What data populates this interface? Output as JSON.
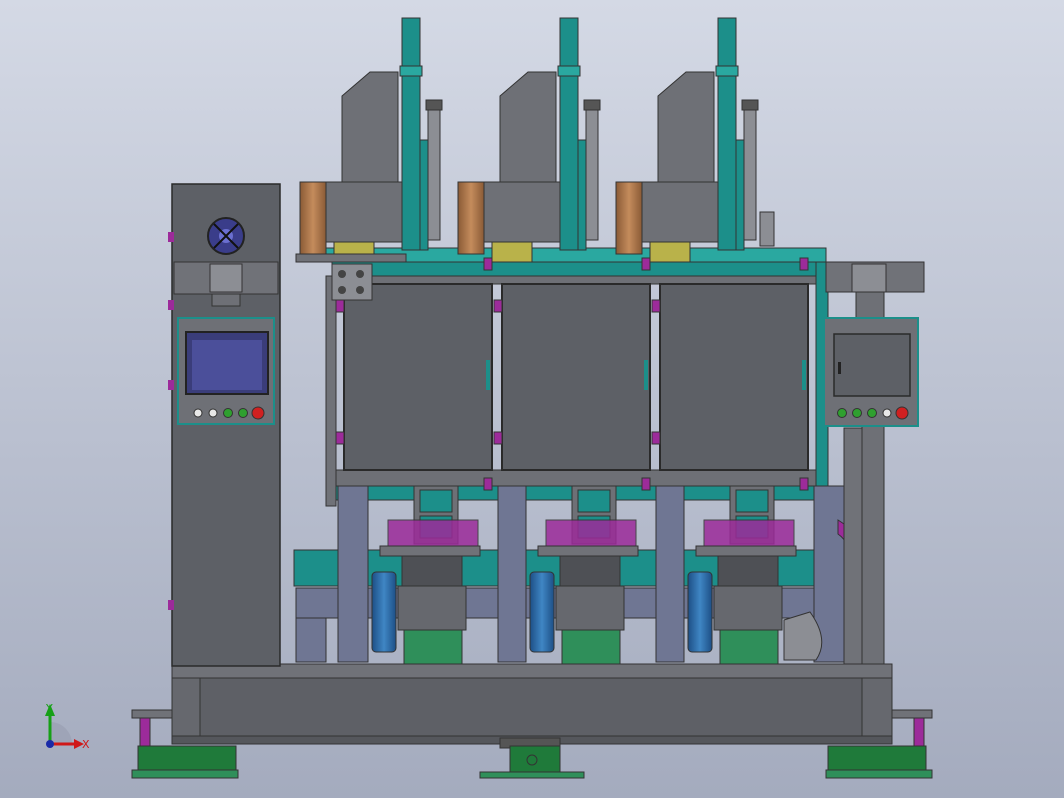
{
  "view": {
    "background_top": "#d4d9e5",
    "background_bottom": "#a4abbe"
  },
  "colors": {
    "teal": "#1c8f8a",
    "teal_light": "#2aa8a0",
    "dark_gray": "#58595c",
    "mid_gray": "#6e7076",
    "light_gray": "#8c8e94",
    "panel_gray": "#5d6066",
    "steel_blue": "#6f7693",
    "copper": "#b2784a",
    "olive": "#b9b24a",
    "green": "#2f8f5a",
    "dark_green": "#1f7a3a",
    "magenta": "#9c2b9a",
    "blue_drum": "#2d6aa8",
    "screen": "#4b4f9a",
    "button_red": "#d02020",
    "button_green": "#2fa02f"
  },
  "triad": {
    "x_label": "X",
    "y_label": "Y"
  },
  "stations": [
    {
      "id": "station-1"
    },
    {
      "id": "station-2"
    },
    {
      "id": "station-3"
    }
  ]
}
